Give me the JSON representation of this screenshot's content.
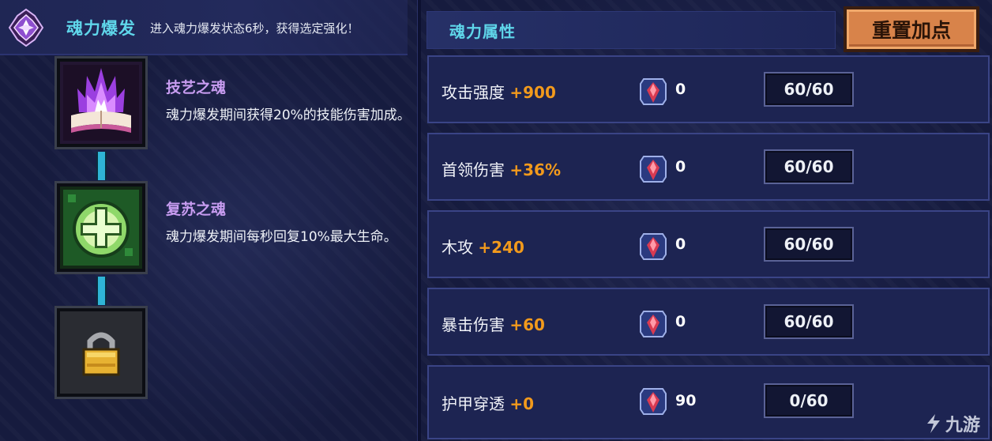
{
  "burst": {
    "title": "魂力爆发",
    "description": "进入魂力爆发状态6秒，获得选定强化！"
  },
  "souls": [
    {
      "name": "技艺之魂",
      "name_color": "#c79cf0",
      "description": "魂力爆发期间获得20%的技能伤害加成。",
      "icon": "purple-flame-book-icon"
    },
    {
      "name": "复苏之魂",
      "name_color": "#c79cf0",
      "description": "魂力爆发期间每秒回复10%最大生命。",
      "icon": "green-heal-cross-icon"
    },
    {
      "name": "",
      "description": "",
      "icon": "padlock-icon"
    }
  ],
  "attributes": {
    "title": "魂力属性",
    "reset_label": "重置加点",
    "rows": [
      {
        "label": "攻击强度",
        "bonus": "+900",
        "cost": "0",
        "level": "60/60"
      },
      {
        "label": "首领伤害",
        "bonus": "+36%",
        "cost": "0",
        "level": "60/60"
      },
      {
        "label": "木攻",
        "bonus": "+240",
        "cost": "0",
        "level": "60/60"
      },
      {
        "label": "暴击伤害",
        "bonus": "+60",
        "cost": "0",
        "level": "60/60"
      },
      {
        "label": "护甲穿透",
        "bonus": "+0",
        "cost": "90",
        "level": "0/60"
      }
    ]
  },
  "watermark": {
    "text": "九游"
  },
  "colors": {
    "accent_cyan": "#5fd6ea",
    "bonus_orange": "#f29a1c",
    "button_orange": "#d8834a"
  }
}
